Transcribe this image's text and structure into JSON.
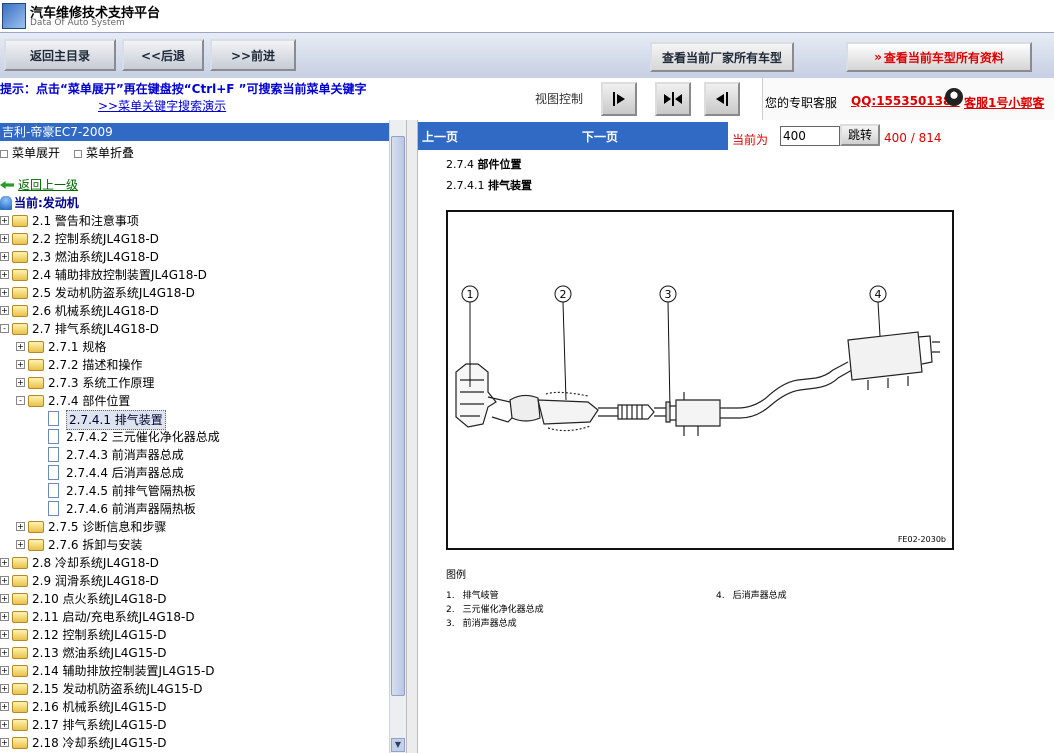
{
  "app": {
    "title": "汽车维修技术支持平台",
    "subtitle": "Data Of Auto System"
  },
  "toolbar": {
    "home": "返回主目录",
    "back": "<<后退",
    "forward": ">>前进",
    "makers": "查看当前厂家所有车型",
    "all_info": "查看当前车型所有资料"
  },
  "hint": {
    "text": "提示：点击“菜单展开”再在键盘按“Ctrl+F ”可搜索当前菜单关键字",
    "link": ">>菜单关键字搜索演示",
    "view_control": "视图控制"
  },
  "service": {
    "label": "您的专职客服",
    "qq": "QQ:1553501388",
    "name": "客服1号小郭客"
  },
  "tree": {
    "header": "吉利-帝豪EC7-2009",
    "expand": "菜单展开",
    "collapse": "菜单折叠",
    "up": "返回上一级",
    "current": "当前:发动机",
    "items": [
      {
        "label": "2.1 警告和注意事项"
      },
      {
        "label": "2.2 控制系统JL4G18-D"
      },
      {
        "label": "2.3 燃油系统JL4G18-D"
      },
      {
        "label": "2.4 辅助排放控制装置JL4G18-D"
      },
      {
        "label": "2.5 发动机防盗系统JL4G18-D"
      },
      {
        "label": "2.6 机械系统JL4G18-D"
      },
      {
        "label": "2.7 排气系统JL4G18-D"
      },
      {
        "label": "2.7.1 规格"
      },
      {
        "label": "2.7.2 描述和操作"
      },
      {
        "label": "2.7.3 系统工作原理"
      },
      {
        "label": "2.7.4 部件位置"
      },
      {
        "label": "2.7.4.1 排气装置"
      },
      {
        "label": "2.7.4.2 三元催化净化器总成"
      },
      {
        "label": "2.7.4.3 前消声器总成"
      },
      {
        "label": "2.7.4.4 后消声器总成"
      },
      {
        "label": "2.7.4.5 前排气管隔热板"
      },
      {
        "label": "2.7.4.6 前消声器隔热板"
      },
      {
        "label": "2.7.5 诊断信息和步骤"
      },
      {
        "label": "2.7.6 拆卸与安装"
      },
      {
        "label": "2.8 冷却系统JL4G18-D"
      },
      {
        "label": "2.9 润滑系统JL4G18-D"
      },
      {
        "label": "2.10 点火系统JL4G18-D"
      },
      {
        "label": "2.11 启动/充电系统JL4G18-D"
      },
      {
        "label": "2.12 控制系统JL4G15-D"
      },
      {
        "label": "2.13 燃油系统JL4G15-D"
      },
      {
        "label": "2.14 辅助排放控制装置JL4G15-D"
      },
      {
        "label": "2.15 发动机防盗系统JL4G15-D"
      },
      {
        "label": "2.16 机械系统JL4G15-D"
      },
      {
        "label": "2.17 排气系统JL4G15-D"
      },
      {
        "label": "2.18 冷却系统JL4G15-D"
      }
    ]
  },
  "doc": {
    "prev": "上一页",
    "next": "下一页",
    "current_label": "当前为",
    "page_value": "400",
    "jump": "跳转",
    "page_count": "400 / 814",
    "section_num": "2.7.4",
    "section_title": "部件位置",
    "sub_num": "2.7.4.1",
    "sub_title": "排气装置",
    "figure_code": "FE02-2030b",
    "callouts": [
      "1",
      "2",
      "3",
      "4"
    ],
    "legend_title": "图例",
    "legend": [
      {
        "num": "1.",
        "text": "排气岐管"
      },
      {
        "num": "2.",
        "text": "三元催化净化器总成"
      },
      {
        "num": "3.",
        "text": "前消声器总成"
      },
      {
        "num": "4.",
        "text": "后消声器总成"
      }
    ]
  }
}
